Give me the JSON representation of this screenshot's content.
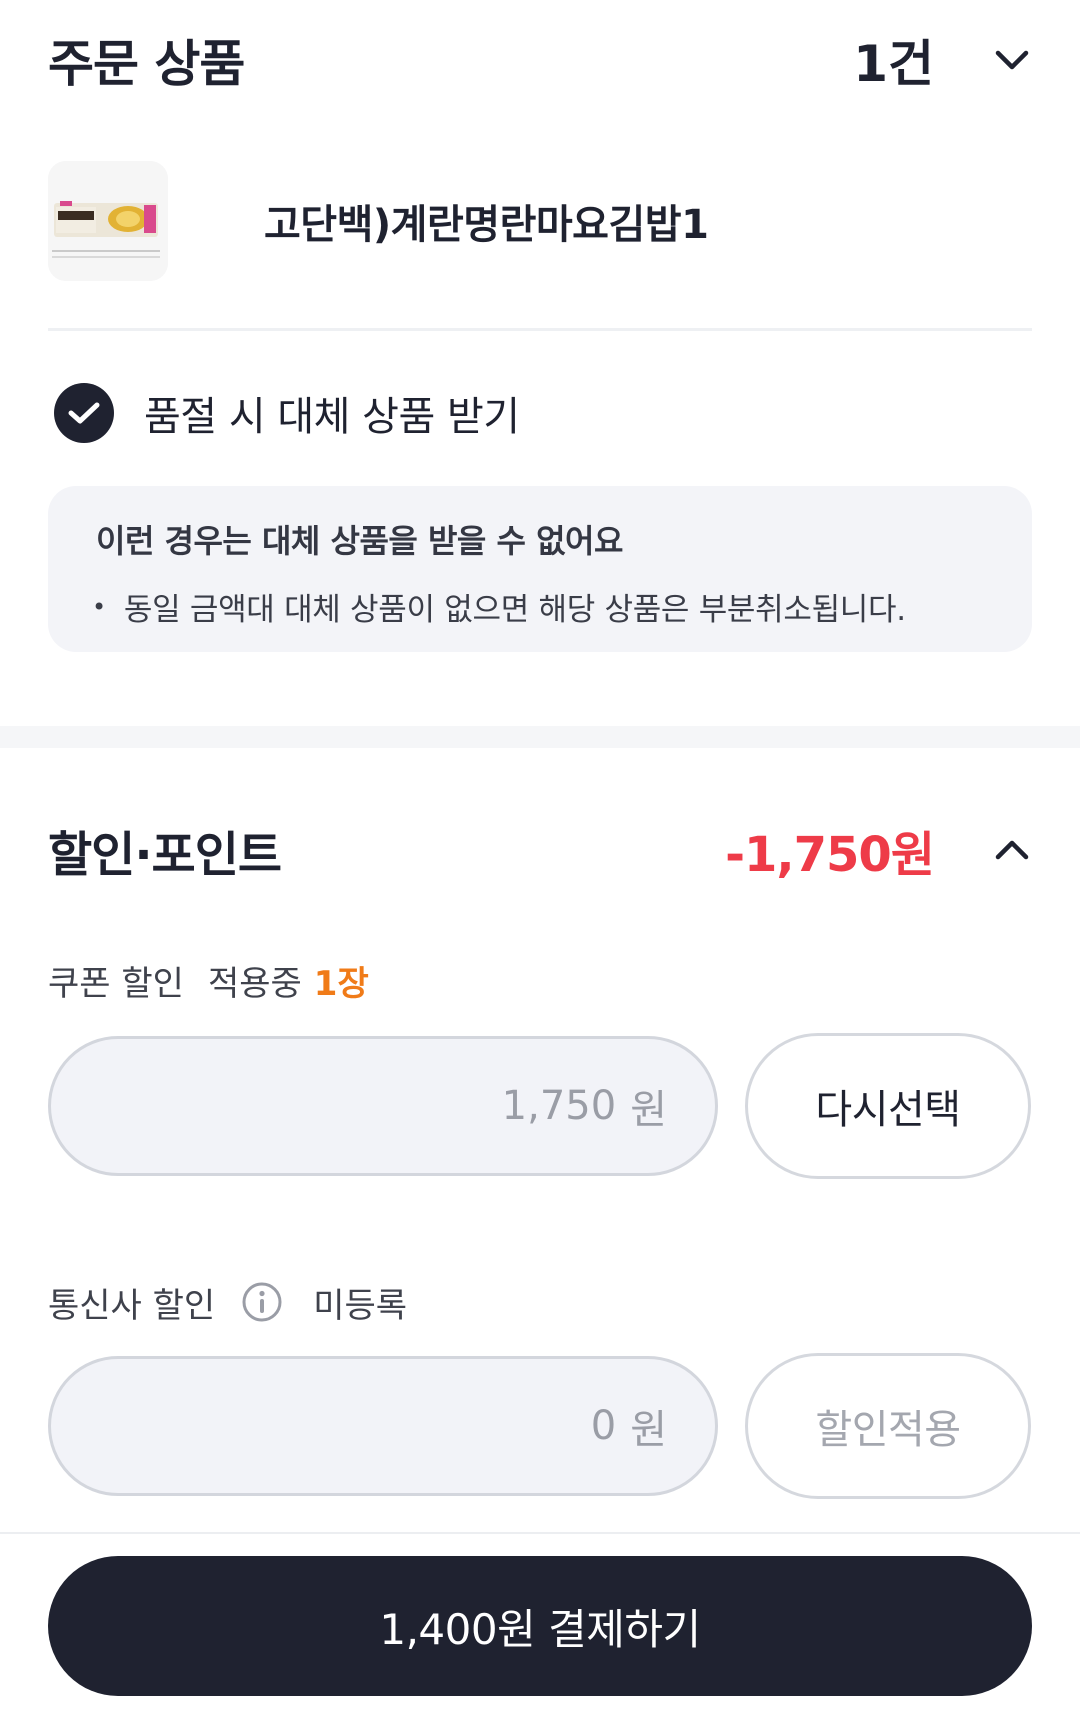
{
  "order": {
    "title": "주문 상품",
    "count": "1건",
    "product": {
      "name": "고단백)계란명란마요김밥1"
    },
    "substitute": {
      "label": "품절 시 대체 상품 받기",
      "checked": true
    },
    "notice": {
      "title": "이런 경우는 대체 상품을 받을 수 없어요",
      "bullet": "•",
      "line": "동일 금액대 대체 상품이 없으면 해당 상품은 부분취소됩니다."
    }
  },
  "discount": {
    "title": "할인·포인트",
    "amount": "-1,750원",
    "coupon": {
      "label": "쿠폰 할인",
      "status": "적용중",
      "count": "1장",
      "value": "1,750",
      "unit": "원",
      "button": "다시선택"
    },
    "carrier": {
      "label": "통신사 할인",
      "status": "미등록",
      "value": "0",
      "unit": "원",
      "button": "할인적용"
    }
  },
  "pay": {
    "label": "1,400원 결제하기"
  },
  "colors": {
    "primary": "#1f2230",
    "discount_red": "#ee3b48",
    "coupon_orange": "#f07b18",
    "field_bg": "#f2f3f8"
  }
}
